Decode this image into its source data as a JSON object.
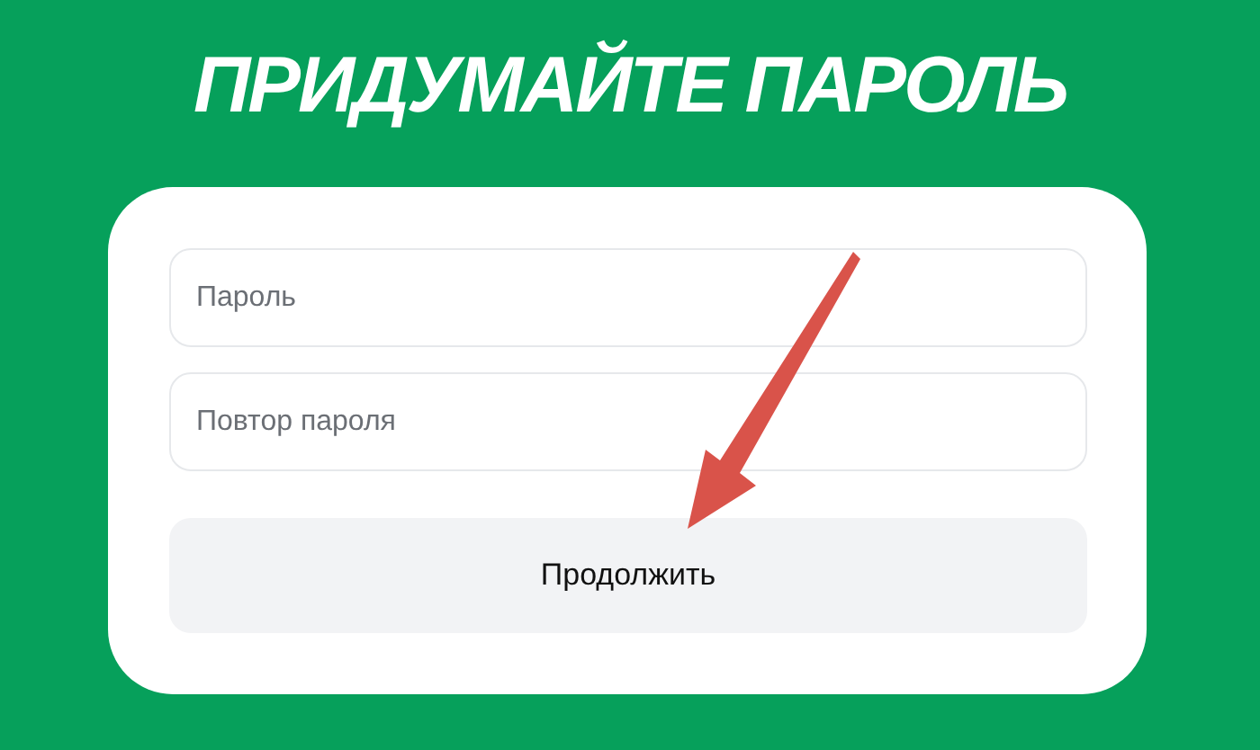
{
  "title": "ПРИДУМАЙТЕ ПАРОЛЬ",
  "fields": [
    {
      "placeholder": "Пароль"
    },
    {
      "placeholder": "Повтор пароля"
    }
  ],
  "button": "Продолжить"
}
